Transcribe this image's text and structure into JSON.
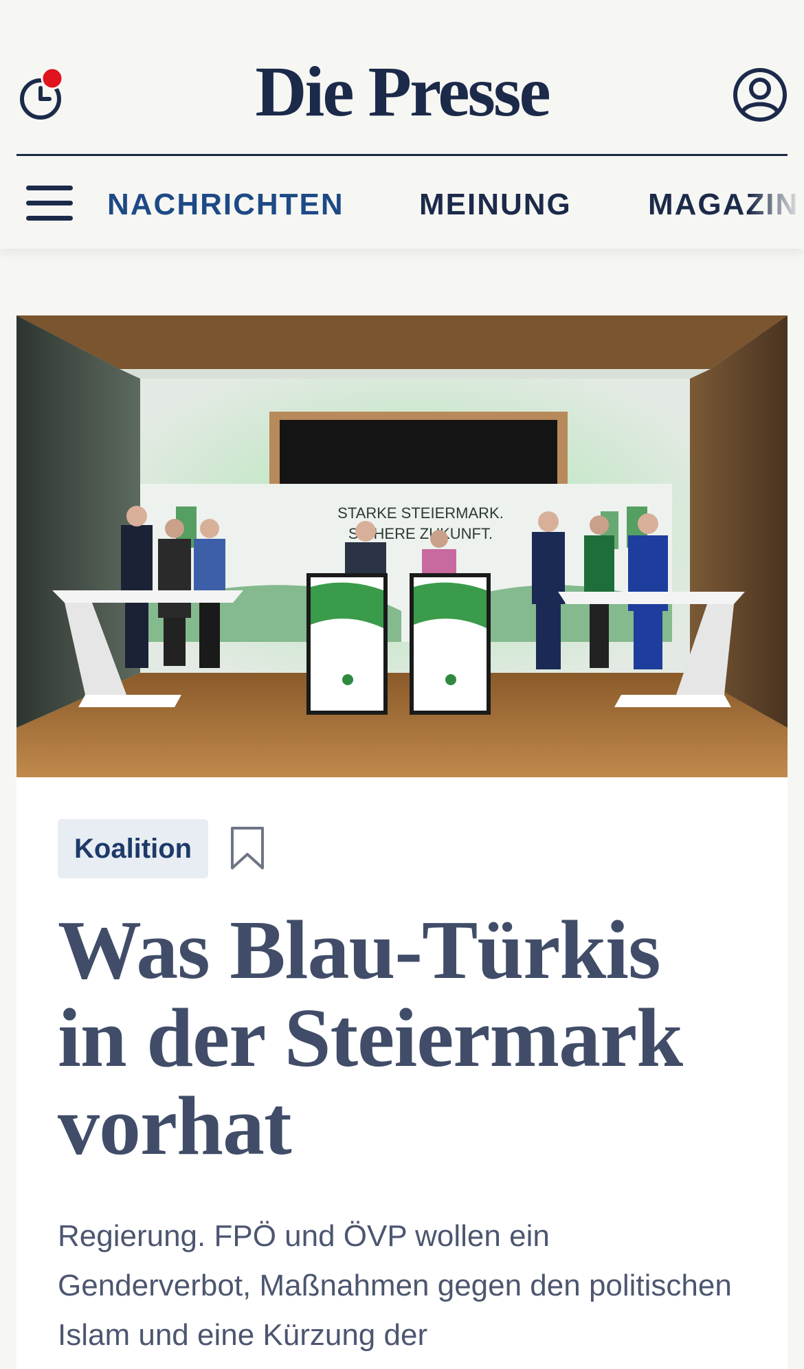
{
  "header": {
    "logo_text": "Die Presse",
    "clock_icon": "clock-icon",
    "notification_dot_color": "#e0141e",
    "user_icon": "user-account-icon",
    "brand_color": "#1c2a4a"
  },
  "nav": {
    "menu_icon": "hamburger-menu-icon",
    "items": [
      {
        "label": "NACHRICHTEN",
        "active": true
      },
      {
        "label": "MEINUNG",
        "active": false
      },
      {
        "label": "MAGAZIN",
        "active": false
      }
    ]
  },
  "article": {
    "image_icon": "press-conference-photo",
    "image_banner": {
      "line1": "STARKE STEIERMARK.",
      "line2": "SICHERE ZUKUNFT."
    },
    "tag": "Koalition",
    "bookmark_icon": "bookmark-icon",
    "headline": "Was Blau-Türkis in der Steiermark vorhat",
    "lede": "Regierung. FPÖ und ÖVP wollen ein Genderverbot, Maßnahmen gegen den politischen Islam und eine Kürzung der"
  }
}
